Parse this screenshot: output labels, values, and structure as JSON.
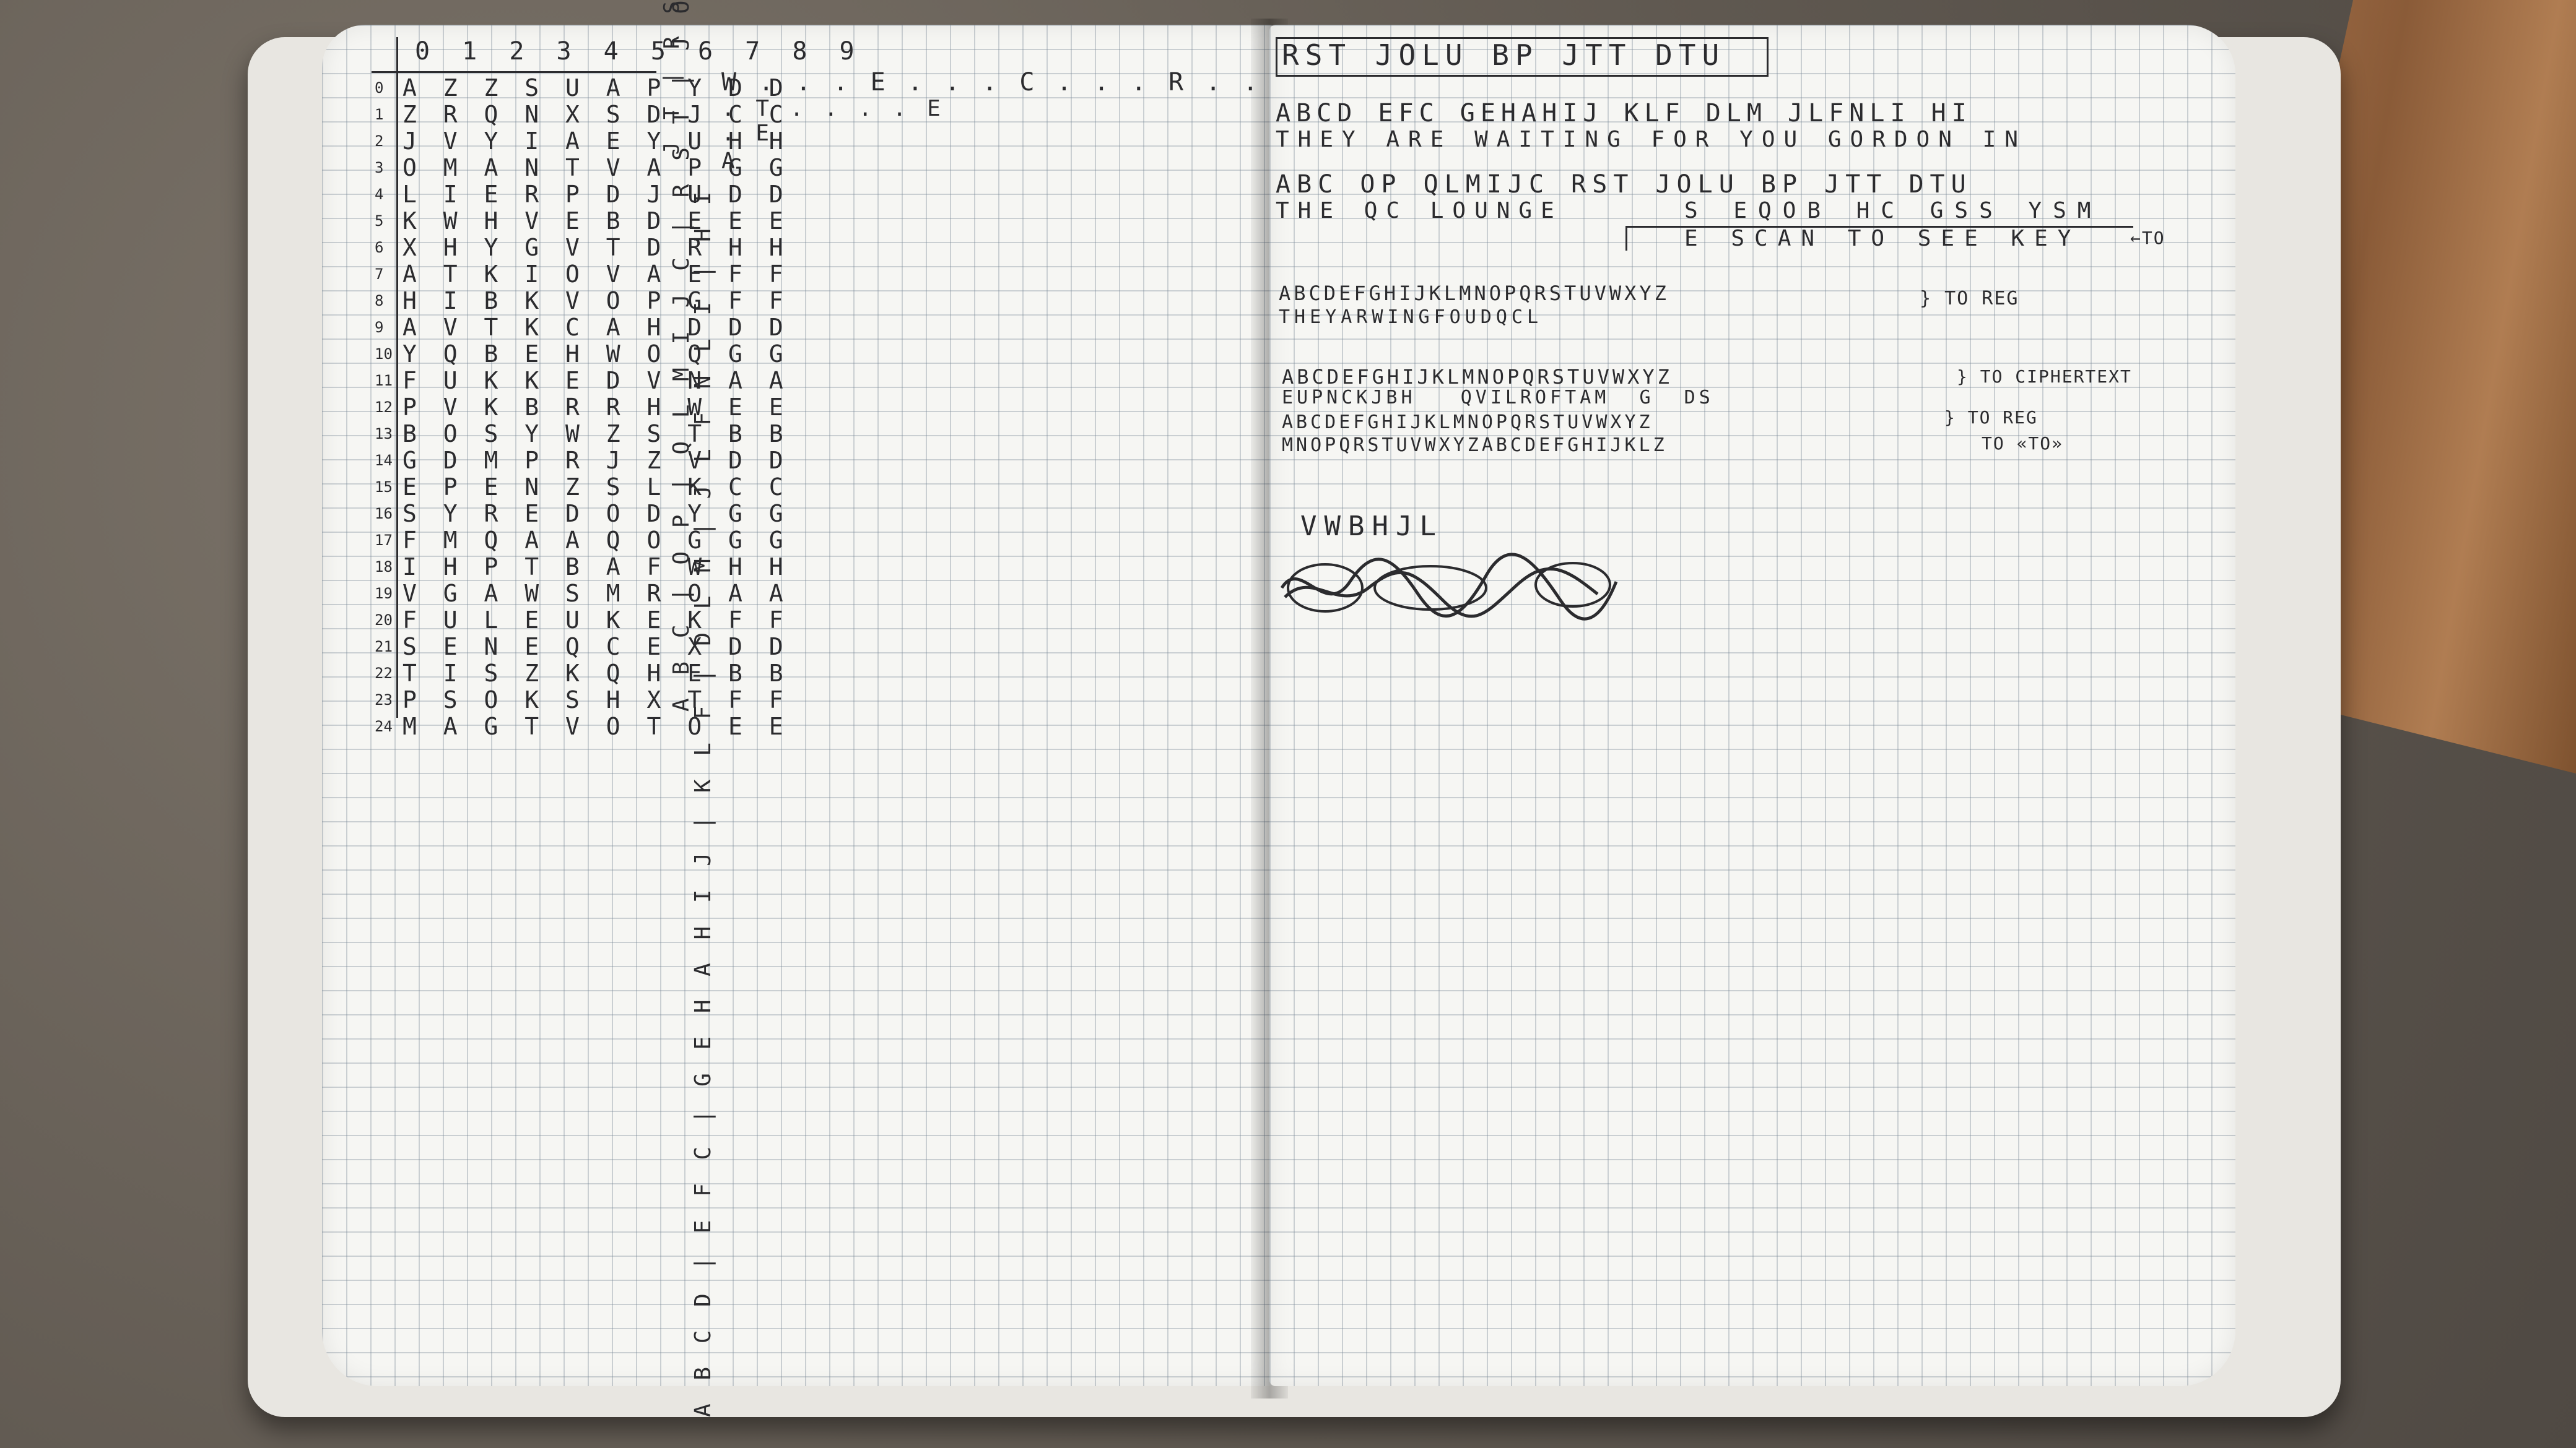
{
  "left_page": {
    "grid_header": "0 1 2 3 4 5 6 7 8 9",
    "grid_rows": [
      {
        "num": "0",
        "text": "A Z Z S U A P Y D D"
      },
      {
        "num": "1",
        "text": "Z R Q N X S D J C C"
      },
      {
        "num": "2",
        "text": "J V Y I A E Y U H H"
      },
      {
        "num": "3",
        "text": "O M A N T V A P G G"
      },
      {
        "num": "4",
        "text": "L I E R P D J U D D"
      },
      {
        "num": "5",
        "text": "K W H V E B D E E E"
      },
      {
        "num": "6",
        "text": "X H Y G V T D R H H"
      },
      {
        "num": "7",
        "text": "A T K I O V A E F F"
      },
      {
        "num": "8",
        "text": "H I B K V O P G F F"
      },
      {
        "num": "9",
        "text": "A V T K C A H D D D"
      },
      {
        "num": "10",
        "text": "Y Q B E H W O Q G G"
      },
      {
        "num": "11",
        "text": "F U K K E D V N A A"
      },
      {
        "num": "12",
        "text": "P V K B R R H W E E"
      },
      {
        "num": "13",
        "text": "B O S Y W Z S T B B"
      },
      {
        "num": "14",
        "text": "G D M P R J Z V D D"
      },
      {
        "num": "15",
        "text": "E P E N Z S L K C C"
      },
      {
        "num": "16",
        "text": "S Y R E D O D Y G G"
      },
      {
        "num": "17",
        "text": "F M Q A A Q O G G G"
      },
      {
        "num": "18",
        "text": "I H P T B A F W H H"
      },
      {
        "num": "19",
        "text": "V G A W S M R O A A"
      },
      {
        "num": "20",
        "text": "F U L E U K E K F F"
      },
      {
        "num": "21",
        "text": "S E N E Q C E X D D"
      },
      {
        "num": "22",
        "text": "T I S Z K Q H E B B"
      },
      {
        "num": "23",
        "text": "P S O K S H X T F F"
      },
      {
        "num": "24",
        "text": "M A G T V O T O E E"
      }
    ],
    "vertical_inner": "J T | R S T | J O L U | B P | J T T | D T U",
    "vertical_outer": "A B C D | E F C | G E H A H I J | K L F | D L M | J L F N L I | H I",
    "vertical_mid": "A B C | O P | Q L M I J C | R S T | J O L U | B P | J T",
    "top_notes_line1": "W . . . E . . . C . . . R . . . . L . .",
    "top_notes_line2": ". T . . . . E",
    "top_notes_line3": ". E",
    "top_notes_line4": "A"
  },
  "right_page": {
    "boxed_header": "RST JOLU BP JTT DTU",
    "line1_cipher": "ABCD EFC GEHAHIJ KLF DLM JLFNLI HI",
    "line1_plain": "THEY ARE WAITING FOR YOU GORDON IN",
    "line2_cipher": "ABC OP QLMIJC RST JOLU BP JTT DTU",
    "line2_plain": "THE QC LOUNGE",
    "line2_sub": "S EQOB HC GSS YSM",
    "line2_bracket_text": "E SCAN TO SEE KEY",
    "line2_arrow": "←TO",
    "alpha1": "ABCDEFGHIJKLMNOPQRSTUVWXYZ",
    "alpha1_map": "THEYARWINGFOUDQCL",
    "alpha1_note": "} TO REG",
    "alpha2": "ABCDEFGHIJKLMNOPQRSTUVWXYZ",
    "alpha2_map": "EUPNCKJBH   QVILROFTAM  G  DS",
    "alpha2_note": "} TO CIPHERTEXT",
    "alpha3": "ABCDEFGHIJKLMNOPQRSTUVWXYZ",
    "alpha3_note": "} TO REG",
    "alpha4": "MNOPQRSTUVWXYZABCDEFGHIJKLZ",
    "alpha4_note": "TO «TO»",
    "word": "VWBHJL"
  }
}
